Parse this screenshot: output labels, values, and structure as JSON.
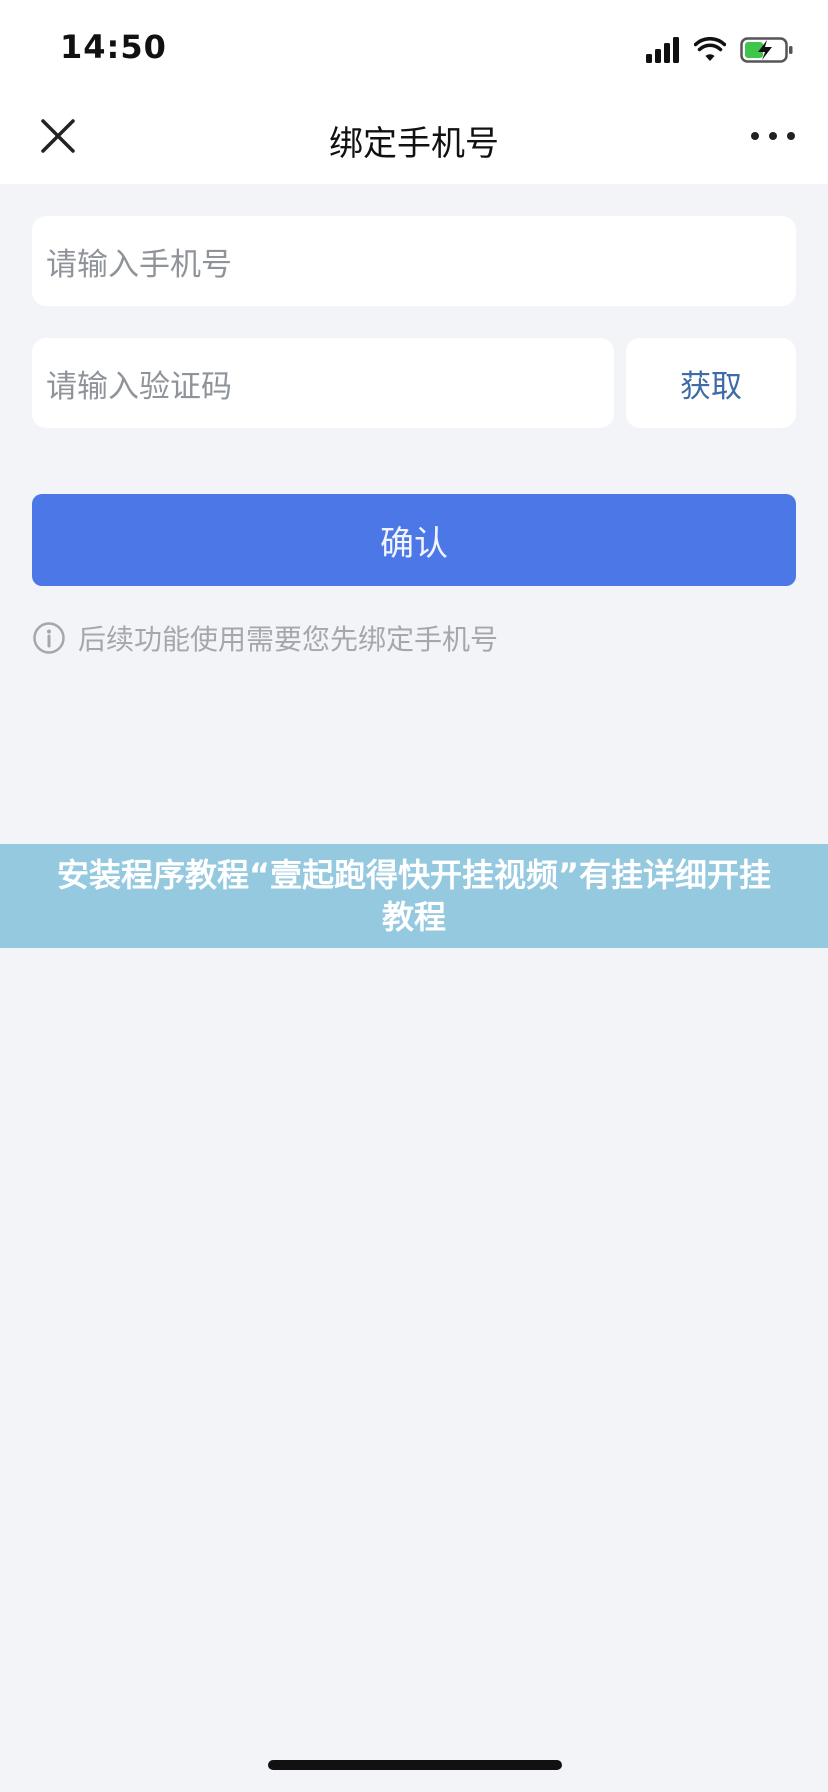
{
  "status_bar": {
    "time": "14:50"
  },
  "nav": {
    "title": "绑定手机号"
  },
  "form": {
    "phone_placeholder": "请输入手机号",
    "code_placeholder": "请输入验证码",
    "get_code_label": "获取",
    "confirm_label": "确认",
    "hint": "后续功能使用需要您先绑定手机号"
  },
  "banner": {
    "text": "安装程序教程“壹起跑得快开挂视频”有挂详细开挂教程"
  },
  "colors": {
    "accent": "#4b78e6",
    "link": "#3f6ba8",
    "background": "#f2f4f7",
    "banner": "#94c9e0"
  }
}
